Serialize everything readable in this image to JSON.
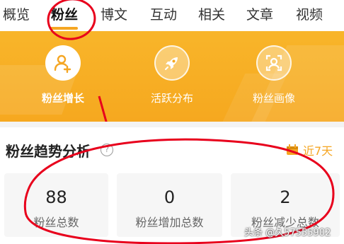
{
  "tabs": [
    "概览",
    "粉丝",
    "博文",
    "互动",
    "相关",
    "文章",
    "视频"
  ],
  "banner": {
    "items": [
      {
        "label": "粉丝增长",
        "icon": "user-add-icon"
      },
      {
        "label": "活跃分布",
        "icon": "rocket-icon"
      },
      {
        "label": "粉丝画像",
        "icon": "portrait-icon"
      }
    ]
  },
  "section": {
    "title": "粉丝趋势分析",
    "help": "?",
    "range": "近7天"
  },
  "stats": [
    {
      "value": "88",
      "label": "粉丝总数"
    },
    {
      "value": "0",
      "label": "粉丝增加总数"
    },
    {
      "value": "2",
      "label": "粉丝减少总数"
    }
  ],
  "watermark": "头条 @久57555902",
  "colors": {
    "accent": "#f5a623",
    "banner": "#f7ad24",
    "annotation": "#e8001c"
  }
}
